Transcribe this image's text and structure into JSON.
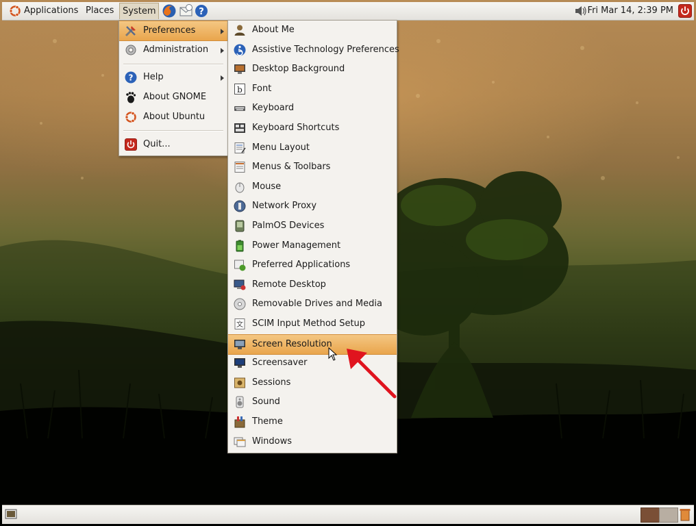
{
  "top_panel": {
    "applications_label": "Applications",
    "places_label": "Places",
    "system_label": "System",
    "clock": "Fri Mar 14,  2:39 PM"
  },
  "system_menu": {
    "items": [
      {
        "label": "Preferences",
        "icon": "preferences-icon",
        "submenu": true
      },
      {
        "label": "Administration",
        "icon": "administration-icon",
        "submenu": true
      },
      {
        "label": "Help",
        "icon": "help-icon",
        "submenu": true
      },
      {
        "label": "About GNOME",
        "icon": "gnome-foot-icon",
        "submenu": false
      },
      {
        "label": "About Ubuntu",
        "icon": "ubuntu-logo-icon",
        "submenu": false
      },
      {
        "label": "Quit...",
        "icon": "power-icon",
        "submenu": false
      }
    ]
  },
  "preferences_menu": {
    "items": [
      {
        "label": "About Me",
        "icon": "user-icon"
      },
      {
        "label": "Assistive Technology Preferences",
        "icon": "accessibility-icon"
      },
      {
        "label": "Desktop Background",
        "icon": "desktop-background-icon"
      },
      {
        "label": "Font",
        "icon": "font-icon"
      },
      {
        "label": "Keyboard",
        "icon": "keyboard-icon"
      },
      {
        "label": "Keyboard Shortcuts",
        "icon": "keyboard-shortcuts-icon"
      },
      {
        "label": "Menu Layout",
        "icon": "menu-layout-icon"
      },
      {
        "label": "Menus & Toolbars",
        "icon": "menus-toolbars-icon"
      },
      {
        "label": "Mouse",
        "icon": "mouse-icon"
      },
      {
        "label": "Network Proxy",
        "icon": "network-proxy-icon"
      },
      {
        "label": "PalmOS Devices",
        "icon": "palm-device-icon"
      },
      {
        "label": "Power Management",
        "icon": "power-management-icon"
      },
      {
        "label": "Preferred Applications",
        "icon": "preferred-applications-icon"
      },
      {
        "label": "Remote Desktop",
        "icon": "remote-desktop-icon"
      },
      {
        "label": "Removable Drives and Media",
        "icon": "removable-media-icon"
      },
      {
        "label": "SCIM Input Method Setup",
        "icon": "scim-icon"
      },
      {
        "label": "Screen Resolution",
        "icon": "screen-resolution-icon",
        "highlighted": true
      },
      {
        "label": "Screensaver",
        "icon": "screensaver-icon"
      },
      {
        "label": "Sessions",
        "icon": "sessions-icon"
      },
      {
        "label": "Sound",
        "icon": "sound-icon"
      },
      {
        "label": "Theme",
        "icon": "theme-icon"
      },
      {
        "label": "Windows",
        "icon": "windows-icon"
      }
    ]
  },
  "colors": {
    "highlight": "#e9a54c",
    "annotation_arrow": "#e0141e",
    "workspace_1": "#7a4f36",
    "workspace_2": "#b8aea2"
  }
}
